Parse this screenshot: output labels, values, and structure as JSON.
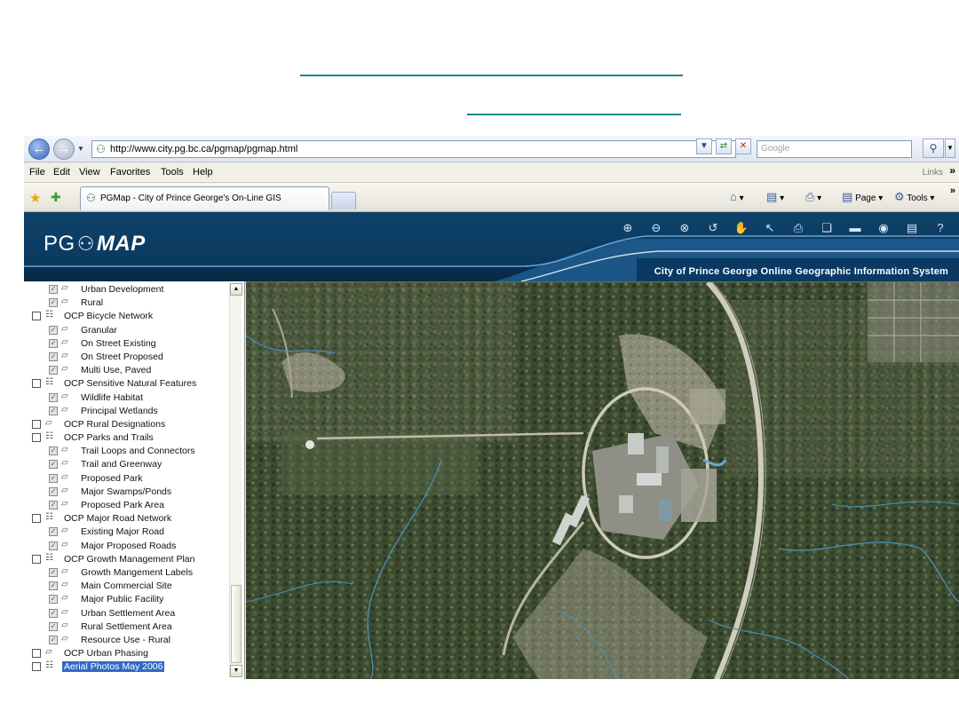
{
  "browser": {
    "url": "http://www.city.pg.bc.ca/pgmap/pgmap.html",
    "search_placeholder": "Google",
    "menu": [
      "File",
      "Edit",
      "View",
      "Favorites",
      "Tools",
      "Help"
    ],
    "links_label": "Links",
    "tab_title": "PGMap - City of Prince George's On-Line GIS",
    "commands": {
      "page": "Page",
      "tools": "Tools"
    }
  },
  "app": {
    "logo_prefix": "PG",
    "logo_suffix": "MAP",
    "header_title": "City of Prince George Online Geographic Information System",
    "toolbar": [
      "zoom-in-icon",
      "zoom-out-icon",
      "zoom-full-icon",
      "zoom-previous-icon",
      "pan-hand-icon",
      "select-pointer-icon",
      "print-icon",
      "copy-icon",
      "measure-icon",
      "find-binoculars-icon",
      "report-icon",
      "help-icon"
    ]
  },
  "layers": [
    {
      "label": "Urban Development",
      "level": "sub",
      "checked": true
    },
    {
      "label": "Rural",
      "level": "sub",
      "checked": true
    },
    {
      "label": "OCP Bicycle Network",
      "level": "top",
      "checked": false,
      "group": true
    },
    {
      "label": "Granular",
      "level": "sub",
      "checked": true
    },
    {
      "label": "On Street Existing",
      "level": "sub",
      "checked": true
    },
    {
      "label": "On Street Proposed",
      "level": "sub",
      "checked": true
    },
    {
      "label": "Multi Use, Paved",
      "level": "sub",
      "checked": true
    },
    {
      "label": "OCP Sensitive Natural Features",
      "level": "top",
      "checked": false,
      "group": true
    },
    {
      "label": "Wildlife Habitat",
      "level": "sub",
      "checked": true
    },
    {
      "label": "Principal Wetlands",
      "level": "sub",
      "checked": true
    },
    {
      "label": "OCP Rural Designations",
      "level": "top",
      "checked": false,
      "group": false
    },
    {
      "label": "OCP Parks and Trails",
      "level": "top",
      "checked": false,
      "group": true
    },
    {
      "label": "Trail Loops and Connectors",
      "level": "sub",
      "checked": true
    },
    {
      "label": "Trail and Greenway",
      "level": "sub",
      "checked": true
    },
    {
      "label": "Proposed Park",
      "level": "sub",
      "checked": true
    },
    {
      "label": "Major Swamps/Ponds",
      "level": "sub",
      "checked": true
    },
    {
      "label": "Proposed Park Area",
      "level": "sub",
      "checked": true
    },
    {
      "label": "OCP Major Road Network",
      "level": "top",
      "checked": false,
      "group": true
    },
    {
      "label": "Existing Major Road",
      "level": "sub",
      "checked": true
    },
    {
      "label": "Major Proposed Roads",
      "level": "sub",
      "checked": true
    },
    {
      "label": "OCP Growth Management Plan",
      "level": "top",
      "checked": false,
      "group": true
    },
    {
      "label": "Growth Mangement Labels",
      "level": "sub",
      "checked": true
    },
    {
      "label": "Main Commercial Site",
      "level": "sub",
      "checked": true
    },
    {
      "label": "Major Public Facility",
      "level": "sub",
      "checked": true
    },
    {
      "label": "Urban Settlement Area",
      "level": "sub",
      "checked": true
    },
    {
      "label": "Rural Settlement Area",
      "level": "sub",
      "checked": true
    },
    {
      "label": "Resource Use - Rural",
      "level": "sub",
      "checked": true
    },
    {
      "label": "OCP Urban Phasing",
      "level": "top",
      "checked": false,
      "group": false
    },
    {
      "label": "Aerial Photos May 2006",
      "level": "top",
      "checked": false,
      "group": true,
      "selected": true
    }
  ]
}
